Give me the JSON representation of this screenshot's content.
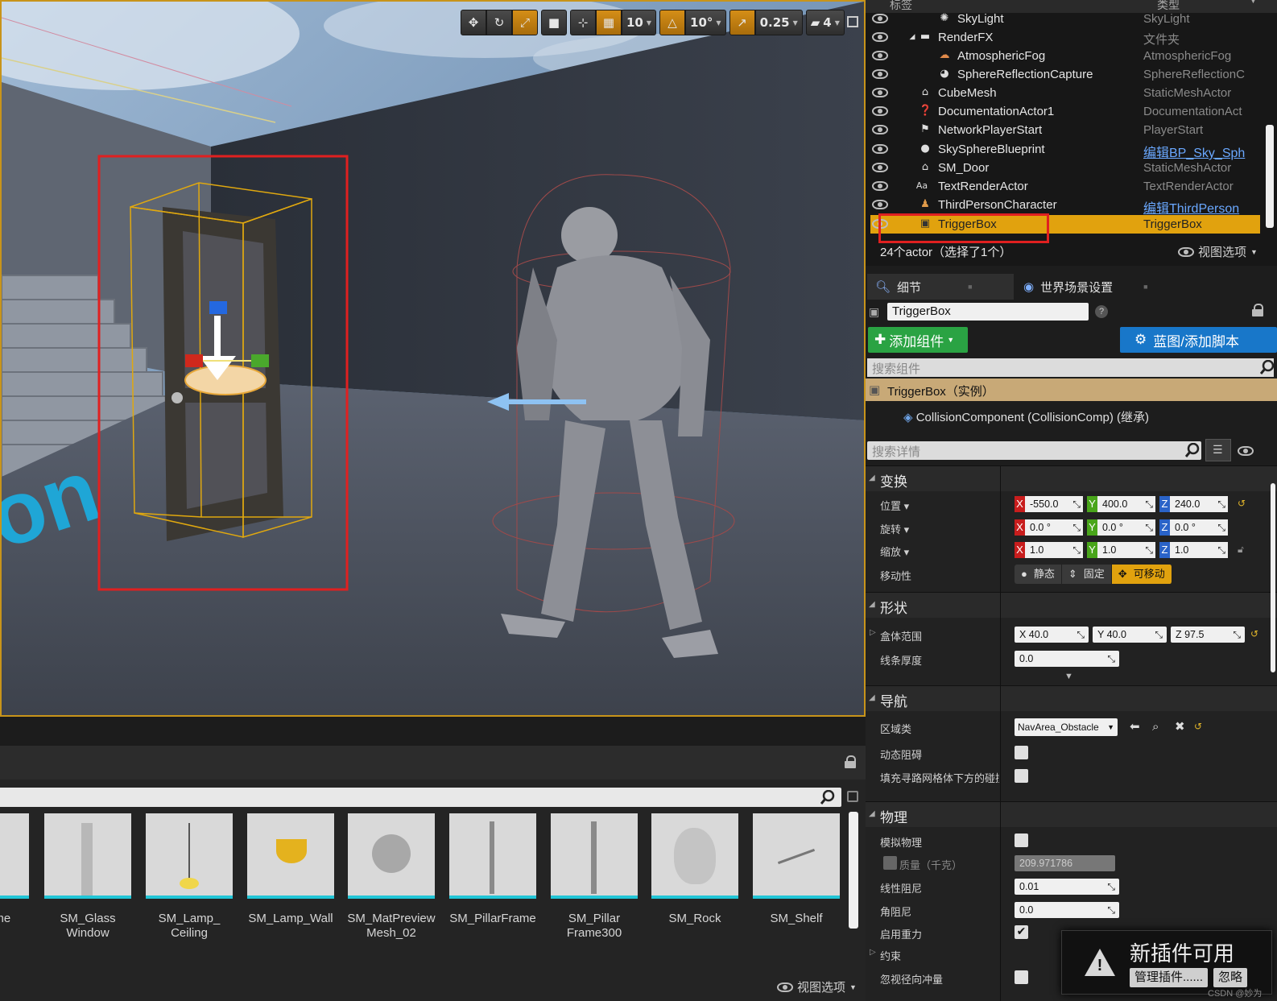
{
  "viewport": {
    "toolbar": {
      "grid_value": "10",
      "rotation_snap": "10°",
      "scale_snap": "0.25",
      "camera_speed": "4"
    },
    "ground_text": "on"
  },
  "outliner": {
    "col_label": "标签",
    "col_type": "类型",
    "rows": [
      {
        "name": "SkyLight",
        "type": "SkyLight",
        "icon": "skylight-icon"
      },
      {
        "name": "RenderFX",
        "type": "文件夹",
        "icon": "folder-icon"
      },
      {
        "name": "AtmosphericFog",
        "type": "AtmosphericFog",
        "icon": "fog-icon"
      },
      {
        "name": "SphereReflectionCapture",
        "type": "SphereReflectionC",
        "icon": "reflection-icon"
      },
      {
        "name": "CubeMesh",
        "type": "StaticMeshActor",
        "icon": "mesh-icon"
      },
      {
        "name": "DocumentationActor1",
        "type": "DocumentationAct",
        "icon": "doc-icon"
      },
      {
        "name": "NetworkPlayerStart",
        "type": "PlayerStart",
        "icon": "player-start-icon"
      },
      {
        "name": "SkySphereBlueprint",
        "type": "编辑BP_Sky_Sph",
        "icon": "sphere-icon"
      },
      {
        "name": "SM_Door",
        "type": "StaticMeshActor",
        "icon": "mesh-icon"
      },
      {
        "name": "TextRenderActor",
        "type": "TextRenderActor",
        "icon": "text-icon"
      },
      {
        "name": "ThirdPersonCharacter",
        "type": "编辑ThirdPerson",
        "icon": "character-icon"
      },
      {
        "name": "TriggerBox",
        "type": "TriggerBox",
        "icon": "triggerbox-icon"
      }
    ],
    "footer": "24个actor（选择了1个）",
    "view_options": "视图选项"
  },
  "details": {
    "tab_details": "细节",
    "tab_world": "世界场景设置",
    "actor_name": "TriggerBox",
    "add_component": "添加组件",
    "blueprint": "蓝图/添加脚本",
    "search_components": "搜索组件",
    "component_root": "TriggerBox（实例）",
    "component_child": "CollisionComponent (CollisionComp) (继承)",
    "search_details": "搜索详情",
    "transform": {
      "title": "变换",
      "location_label": "位置",
      "rotation_label": "旋转",
      "scale_label": "缩放",
      "location": [
        "-550.0",
        "400.0",
        "240.0"
      ],
      "rotation": [
        "0.0 °",
        "0.0 °",
        "0.0 °"
      ],
      "scale": [
        "1.0",
        "1.0",
        "1.0"
      ],
      "mobility_label": "移动性",
      "mobility_static": "静态",
      "mobility_stationary": "固定",
      "mobility_movable": "可移动"
    },
    "shape": {
      "title": "形状",
      "box_extent_label": "盒体范围",
      "box_extent": [
        "X  40.0",
        "Y  40.0",
        "Z  97.5"
      ],
      "line_thickness_label": "线条厚度",
      "line_thickness": "0.0"
    },
    "navigation": {
      "title": "导航",
      "area_class_label": "区域类",
      "area_class": "NavArea_Obstacle",
      "dynamic_obstacle_label": "动态阻碍",
      "fill_collision_label": "填充寻路网格体下方的碰撞"
    },
    "physics": {
      "title": "物理",
      "simulate_label": "模拟物理",
      "mass_label": "质量（千克）",
      "mass": "209.971786",
      "linear_damping_label": "线性阻尼",
      "linear_damping": "0.01",
      "angular_damping_label": "角阻尼",
      "angular_damping": "0.0",
      "gravity_label": "启用重力",
      "constraints_label": "约束",
      "ignore_radial_label": "忽视径向冲量"
    }
  },
  "content_browser": {
    "assets": [
      {
        "label": "rame"
      },
      {
        "label": "SM_Glass\nWindow"
      },
      {
        "label": "SM_Lamp_\nCeiling"
      },
      {
        "label": "SM_Lamp_Wall"
      },
      {
        "label": "SM_MatPreview\nMesh_02"
      },
      {
        "label": "SM_PillarFrame"
      },
      {
        "label": "SM_Pillar\nFrame300"
      },
      {
        "label": "SM_Rock"
      },
      {
        "label": "SM_Shelf"
      }
    ],
    "view_options": "视图选项"
  },
  "notification": {
    "title": "新插件可用",
    "manage_button": "管理插件......",
    "ignore_button": "忽略"
  },
  "watermark": "CSDN @妙为",
  "colors": {
    "selection": "#e1a20e",
    "add_component": "#2aa343",
    "blueprint_button": "#1877c9",
    "viewport_border": "#c8941a",
    "asset_underline": "#21c5d6"
  }
}
